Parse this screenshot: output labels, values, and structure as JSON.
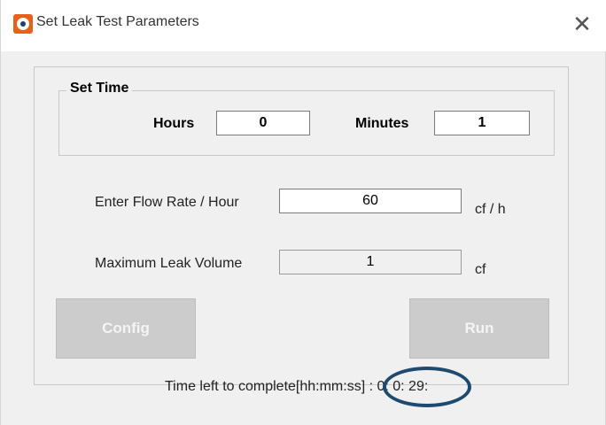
{
  "window": {
    "title": "Set Leak Test Parameters",
    "close_glyph": "✕"
  },
  "set_time": {
    "group_label": "Set Time",
    "hours_label": "Hours",
    "hours_value": "0",
    "minutes_label": "Minutes",
    "minutes_value": "1"
  },
  "flow": {
    "label": "Enter Flow Rate / Hour",
    "value": "60",
    "unit": "cf / h"
  },
  "leak": {
    "label": "Maximum Leak Volume",
    "value": "1",
    "unit": "cf"
  },
  "buttons": {
    "config_label": "Config",
    "run_label": "Run"
  },
  "status": {
    "text": "Time left to complete[hh:mm:ss] : 0: 0: 29:"
  },
  "colors": {
    "highlight_ring": "#1f4a6f",
    "app_icon": "#e8601c",
    "disabled_button": "#cccccc"
  }
}
